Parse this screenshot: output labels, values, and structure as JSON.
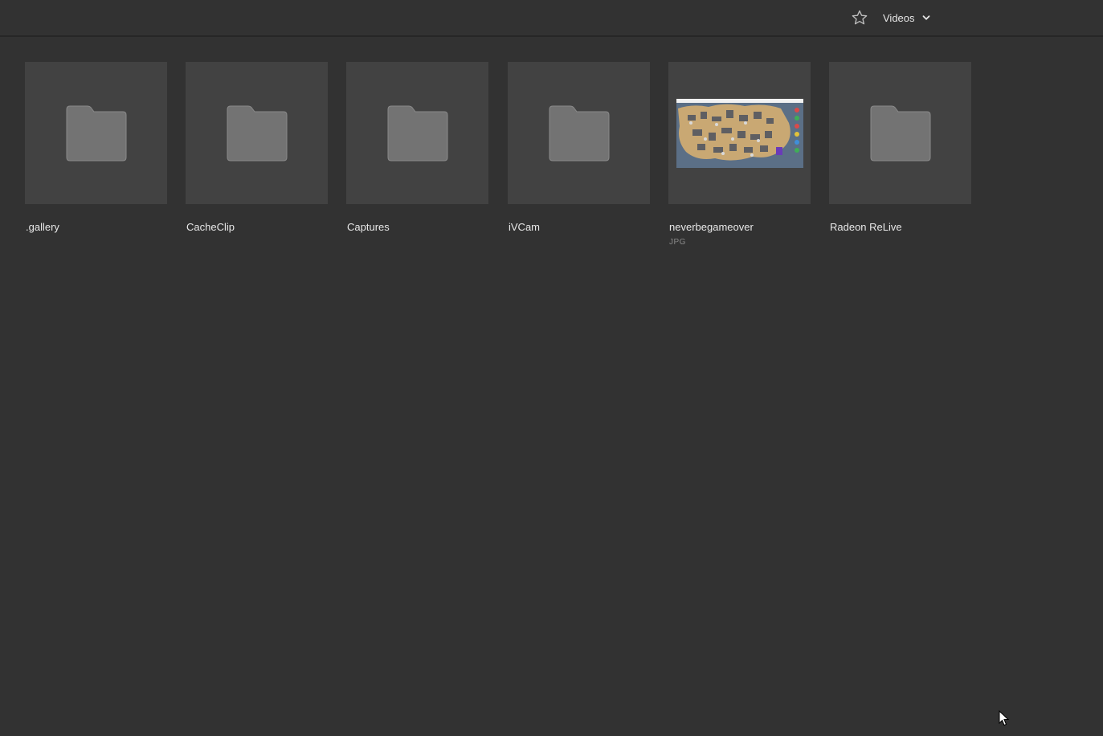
{
  "header": {
    "favorite_icon": "star-outline-icon",
    "location": "Videos",
    "location_chevron": "chevron-down-icon"
  },
  "colors": {
    "background": "#323232",
    "tile_background": "#424242",
    "folder_icon": "#737373",
    "text": "#e6e6e6",
    "subtext": "#8a8a8a"
  },
  "items": [
    {
      "name": ".gallery",
      "kind": "folder",
      "subtitle": ""
    },
    {
      "name": "CacheClip",
      "kind": "folder",
      "subtitle": ""
    },
    {
      "name": "Captures",
      "kind": "folder",
      "subtitle": ""
    },
    {
      "name": "iVCam",
      "kind": "folder",
      "subtitle": ""
    },
    {
      "name": "neverbegameover",
      "kind": "image",
      "subtitle": "JPG"
    },
    {
      "name": "Radeon ReLive",
      "kind": "folder",
      "subtitle": ""
    }
  ]
}
